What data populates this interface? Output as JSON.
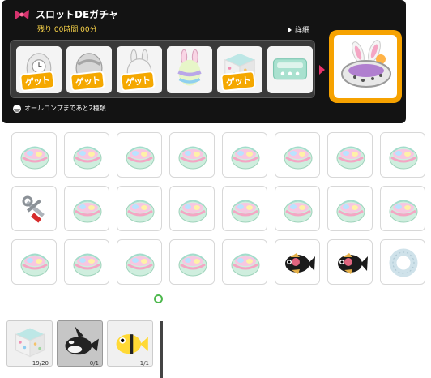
{
  "header": {
    "title": "スロットDEガチャ",
    "remaining": "残り 00時間 00分",
    "details_label": "詳細",
    "complete_text": "オールコンプまであと2種類"
  },
  "slots": [
    {
      "item": "egg-clock",
      "badge": "ゲット"
    },
    {
      "item": "egg-silver",
      "badge": "ゲット"
    },
    {
      "item": "bunny-egg-white",
      "badge": "ゲット"
    },
    {
      "item": "bunny-egg-pastel",
      "badge": ""
    },
    {
      "item": "polka-cube",
      "badge": "ゲット"
    },
    {
      "item": "mint-box",
      "badge": ""
    }
  ],
  "prize": {
    "item": "bunny-nest-basket"
  },
  "colors": {
    "accent": "#f6a200",
    "panel": "#131313",
    "title_sub": "#ffd84a",
    "arrow": "#e8336a"
  },
  "grid": [
    [
      "easter-basket",
      "easter-basket",
      "easter-basket",
      "easter-basket",
      "easter-basket",
      "easter-basket",
      "easter-basket",
      "easter-basket"
    ],
    [
      "wrench-tool",
      "easter-basket",
      "easter-basket",
      "easter-basket",
      "easter-basket",
      "easter-basket",
      "easter-basket",
      "easter-basket"
    ],
    [
      "easter-basket",
      "easter-basket",
      "easter-basket",
      "easter-basket",
      "easter-basket",
      "black-fish",
      "black-fish",
      "donut-ring"
    ]
  ],
  "inventory": [
    {
      "item": "polka-cube",
      "count": "19/20",
      "selected": false
    },
    {
      "item": "orca-plush",
      "count": "0/1",
      "selected": true
    },
    {
      "item": "clownfish-plush",
      "count": "1/1",
      "selected": false
    }
  ]
}
